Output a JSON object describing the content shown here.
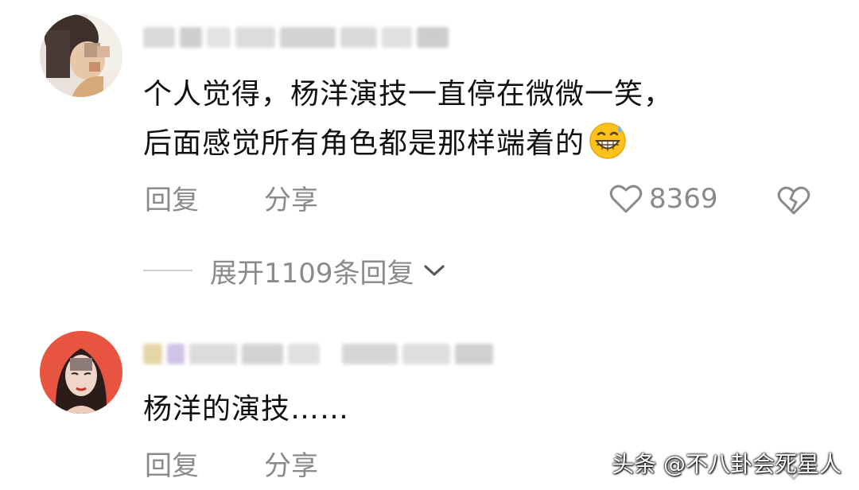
{
  "comments": [
    {
      "text_line1": "个人觉得，杨洋演技一直停在微微一笑，",
      "text_line2": "后面感觉所有角色都是那样端着的",
      "emoji_icon": "grin-sweat-emoji",
      "reply_label": "回复",
      "share_label": "分享",
      "like_count": "8369",
      "expand_label": "展开1109条回复"
    },
    {
      "text": "杨洋的演技……",
      "reply_label": "回复",
      "share_label": "分享"
    }
  ],
  "watermark": "头条 @不八卦会死星人",
  "colors": {
    "text": "#111111",
    "secondary": "#8a8a8a",
    "divider": "#cfcfcf",
    "background": "#ffffff"
  }
}
